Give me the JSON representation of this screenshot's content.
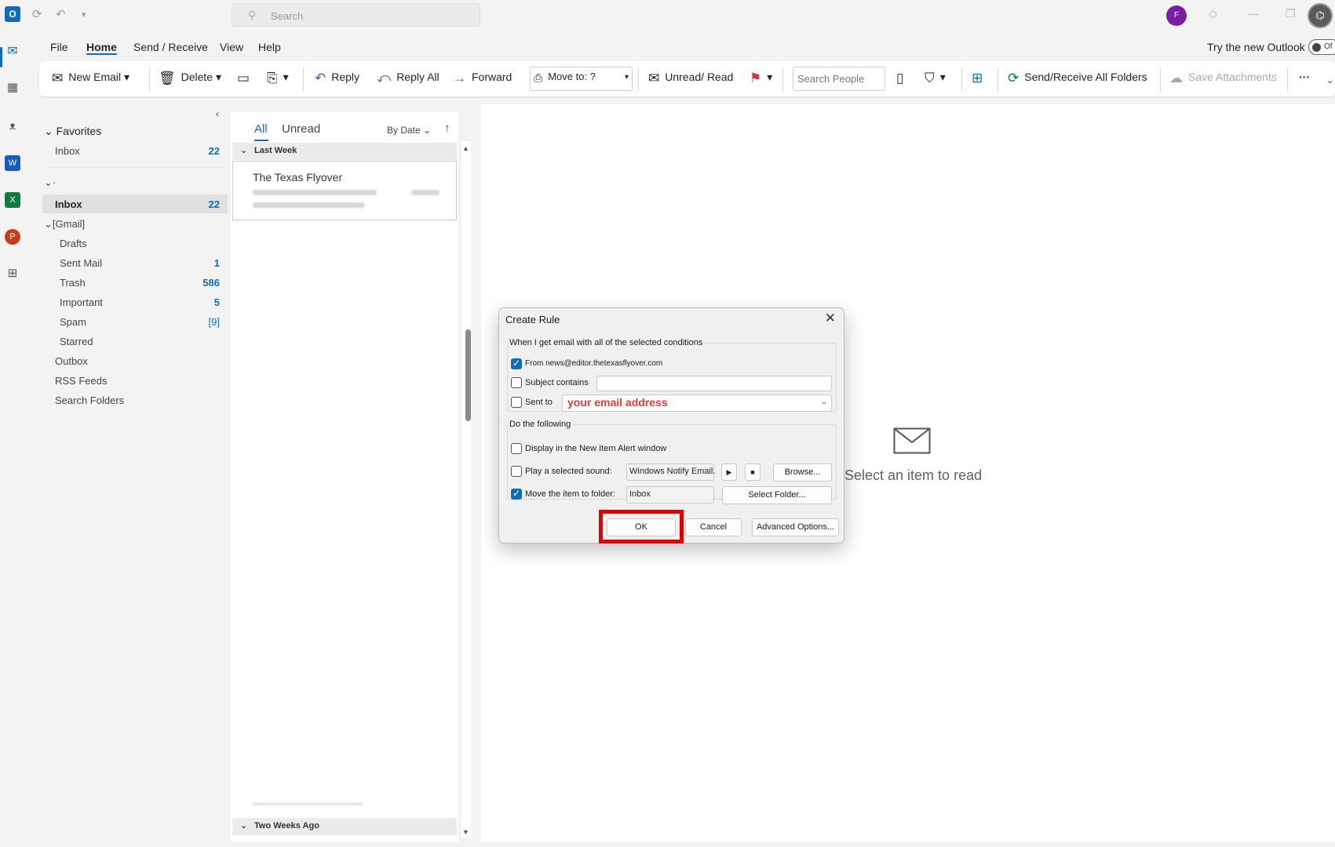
{
  "titlebar": {
    "search_placeholder": "Search",
    "avatar_initial": "F",
    "app_letter": "O"
  },
  "apprail": {
    "word": "W",
    "excel": "X",
    "powerpoint": "P"
  },
  "menu": {
    "file": "File",
    "home": "Home",
    "send_receive": "Send / Receive",
    "view": "View",
    "help": "Help",
    "try_new": "Try the new Outlook",
    "toggle": "Of"
  },
  "ribbon": {
    "new_email": "New Email",
    "delete": "Delete",
    "reply": "Reply",
    "reply_all": "Reply All",
    "forward": "Forward",
    "move_to": "Move to: ?",
    "unread_read": "Unread/ Read",
    "search_people": "Search People",
    "send_receive_all": "Send/Receive All Folders",
    "save_attachments": "Save Attachments",
    "more": "···"
  },
  "folders": {
    "favorites_header": "Favorites",
    "fav_inbox": {
      "label": "Inbox",
      "count": "22"
    },
    "account_header": "·",
    "inbox": {
      "label": "Inbox",
      "count": "22"
    },
    "gmail_header": "[Gmail]",
    "items": [
      {
        "label": "Drafts",
        "count": ""
      },
      {
        "label": "Sent Mail",
        "count": "1"
      },
      {
        "label": "Trash",
        "count": "586"
      },
      {
        "label": "Important",
        "count": "5"
      },
      {
        "label": "Spam",
        "count": "[9]"
      },
      {
        "label": "Starred",
        "count": ""
      }
    ],
    "outbox": "Outbox",
    "rss": "RSS Feeds",
    "search_folders": "Search Folders"
  },
  "msglist": {
    "tab_all": "All",
    "tab_unread": "Unread",
    "sort": "By Date",
    "group_last_week": "Last Week",
    "group_two_weeks": "Two Weeks Ago",
    "message": {
      "sender": "The Texas Flyover"
    }
  },
  "reading": {
    "empty_text": "Select an item to read"
  },
  "dialog": {
    "title": "Create Rule",
    "conditions_label": "When I get email with all of the selected conditions",
    "from_label": "From news@editor.thetexasflyover.com",
    "subject_label": "Subject contains",
    "sent_to_label": "Sent to",
    "sent_to_value": "your email address",
    "do_label": "Do the following",
    "display_label": "Display in the New Item Alert window",
    "play_label": "Play a selected sound:",
    "sound_value": "Windows Notify Email.",
    "browse": "Browse...",
    "move_label": "Move the item to folder:",
    "folder_value": "Inbox",
    "select_folder": "Select Folder...",
    "ok": "OK",
    "cancel": "Cancel",
    "advanced": "Advanced Options...",
    "colors": {
      "highlight_red": "#e00000",
      "accent": "#0f6cbd"
    }
  }
}
